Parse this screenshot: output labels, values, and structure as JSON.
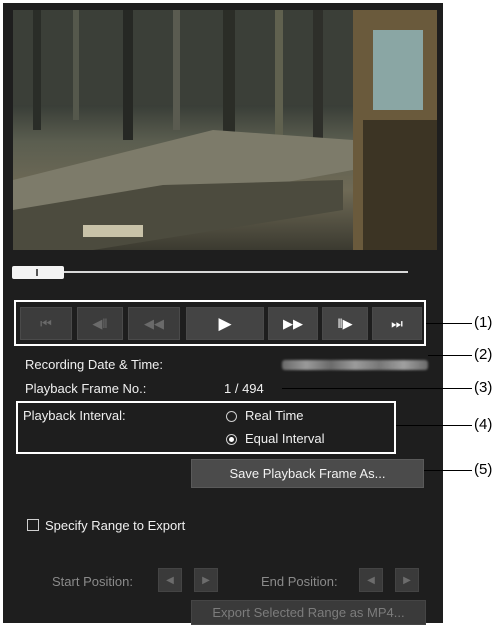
{
  "controls": {
    "first": "⏮",
    "prev_frame": "◀‖",
    "rewind": "◀◀",
    "play": "▶",
    "fast_forward": "▶▶",
    "next_frame": "‖▶",
    "last": "⏭"
  },
  "info": {
    "recording_label": "Recording Date & Time:",
    "frame_label": "Playback Frame No.:",
    "frame_value": "1 / 494"
  },
  "interval": {
    "label": "Playback Interval:",
    "option_realtime": "Real Time",
    "option_equal": "Equal Interval",
    "selected": "Equal Interval"
  },
  "save_button": "Save Playback Frame As...",
  "export": {
    "checkbox_label": "Specify Range to Export",
    "start_label": "Start Position:",
    "end_label": "End Position:",
    "export_button": "Export Selected Range as MP4..."
  },
  "callouts": [
    "(1)",
    "(2)",
    "(3)",
    "(4)",
    "(5)"
  ]
}
